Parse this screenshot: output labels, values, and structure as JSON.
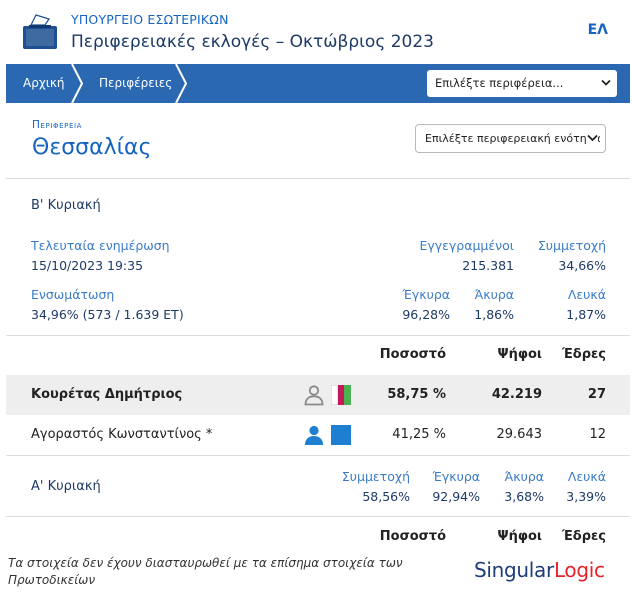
{
  "header": {
    "ministry": "ΥΠΟΥΡΓΕΙΟ ΕΣΩΤΕΡΙΚΩΝ",
    "title": "Περιφερειακές εκλογές – Οκτώβριος 2023",
    "lang": "ΕΛ",
    "logo_icon": "ballot-box-icon"
  },
  "nav": {
    "home": "Αρχική",
    "regions": "Περιφέρειες",
    "select_placeholder": "Επιλέξτε περιφέρεια..."
  },
  "region": {
    "label": "Περιφερεια",
    "name": "Θεσσαλίας",
    "unit_select_placeholder": "Επιλέξτε περιφερειακή ενότητα"
  },
  "round_b": {
    "title": "Β' Κυριακή",
    "last_update_label": "Τελευταία ενημέρωση",
    "last_update_value": "15/10/2023 19:35",
    "registered_label": "Εγγεγραμμένοι",
    "registered_value": "215.381",
    "turnout_label": "Συμμετοχή",
    "turnout_value": "34,66%",
    "integration_label": "Ενσωμάτωση",
    "integration_value": "34,96% (573 / 1.639 ΕΤ)",
    "valid_label": "Έγκυρα",
    "valid_value": "96,28%",
    "invalid_label": "Άκυρα",
    "invalid_value": "1,86%",
    "blank_label": "Λευκά",
    "blank_value": "1,87%"
  },
  "table_headers": {
    "percent": "Ποσοστό",
    "votes": "Ψήφοι",
    "seats": "Έδρες"
  },
  "candidates": [
    {
      "name": "Κουρέτας Δημήτριος",
      "percent": "58,75 %",
      "votes": "42.219",
      "seats": "27",
      "icon": "person-outline-icon",
      "colors": [
        "#4caf50",
        "#ffffff",
        "#c2185b"
      ]
    },
    {
      "name": "Αγοραστός Κωνσταντίνος *",
      "percent": "41,25 %",
      "votes": "29.643",
      "seats": "12",
      "icon": "person-filled-icon",
      "colors": [
        "#1e7fd0"
      ]
    }
  ],
  "round_a": {
    "title": "Α' Κυριακή",
    "turnout_label": "Συμμετοχή",
    "turnout_value": "58,56%",
    "valid_label": "Έγκυρα",
    "valid_value": "92,94%",
    "invalid_label": "Άκυρα",
    "invalid_value": "3,68%",
    "blank_label": "Λευκά",
    "blank_value": "3,39%"
  },
  "footer": {
    "disclaimer": "Τα στοιχεία δεν έχουν διασταυρωθεί με τα επίσημα στοιχεία των Πρωτοδικείων",
    "brand_part1": "Singular",
    "brand_part2": "Logic"
  },
  "colors": {
    "nav_blue": "#2b68b2",
    "accent_blue": "#1565c0",
    "brand_red": "#e8232a"
  }
}
